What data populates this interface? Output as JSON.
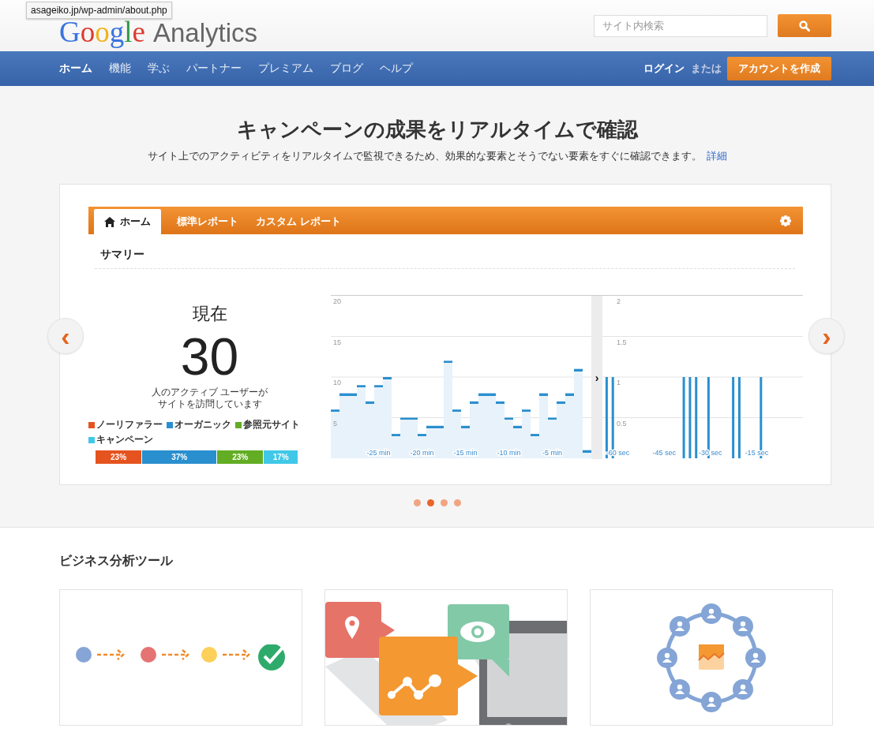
{
  "tooltip": "asageiko.jp/wp-admin/about.php",
  "logo": {
    "brand_letters": [
      {
        "char": "G",
        "color": "#3b73e0"
      },
      {
        "char": "o",
        "color": "#de3a2f"
      },
      {
        "char": "o",
        "color": "#f2b31b"
      },
      {
        "char": "g",
        "color": "#3b73e0"
      },
      {
        "char": "l",
        "color": "#2e9b48"
      },
      {
        "char": "e",
        "color": "#de3a2f"
      }
    ],
    "product": "Analytics"
  },
  "search": {
    "placeholder": "サイト内検索"
  },
  "nav": {
    "items": [
      {
        "label": "ホーム",
        "selected": true
      },
      {
        "label": "機能",
        "selected": false
      },
      {
        "label": "学ぶ",
        "selected": false
      },
      {
        "label": "パートナー",
        "selected": false
      },
      {
        "label": "プレミアム",
        "selected": false
      },
      {
        "label": "ブログ",
        "selected": false
      },
      {
        "label": "ヘルプ",
        "selected": false
      }
    ],
    "login": "ログイン",
    "or": "または",
    "signup": "アカウントを作成"
  },
  "hero": {
    "title": "キャンペーンの成果をリアルタイムで確認",
    "subtitle": "サイト上でのアクティビティをリアルタイムで監視できるため、効果的な要素とそうでない要素をすぐに確認できます。",
    "link": "詳細"
  },
  "dashboard": {
    "tabs": [
      {
        "label": "ホーム",
        "selected": true
      },
      {
        "label": "標準レポート",
        "selected": false
      },
      {
        "label": "カスタム レポート",
        "selected": false
      }
    ],
    "summary_title": "サマリー",
    "now_label": "現在",
    "active_count": "30",
    "description_lines": [
      "人のアクティブ ユーザーが",
      "サイトを訪問しています"
    ],
    "sources": [
      {
        "name": "ノーリファラー",
        "share": "23%",
        "color": "#e5541f"
      },
      {
        "name": "オーガニック",
        "share": "37%",
        "color": "#2a8fcf"
      },
      {
        "name": "参照元サイト",
        "share": "23%",
        "color": "#62ad23"
      },
      {
        "name": "キャンペーン",
        "share": "17%",
        "color": "#41c8e8"
      }
    ],
    "expander": "›",
    "minutes_chart": {
      "chart_data": {
        "type": "bar",
        "grid": true,
        "xlim": [
          -30.5,
          -0.5
        ],
        "x": [
          -30,
          -29,
          -28,
          -27,
          -26,
          -25,
          -24,
          -23,
          -22,
          -21,
          -20,
          -19,
          -18,
          -17,
          -16,
          -15,
          -14,
          -13,
          -12,
          -11,
          -10,
          -9,
          -8,
          -7,
          -6,
          -5,
          -4,
          -3,
          -2,
          -1
        ],
        "series": [
          {
            "color": "#2a8fcf",
            "values": [
              6,
              8,
              8,
              9,
              7,
              9,
              10,
              3,
              5,
              5,
              3,
              4,
              4,
              12,
              6,
              4,
              7,
              8,
              8,
              7,
              5,
              4,
              6,
              3,
              8,
              5,
              7,
              8,
              11,
              1
            ]
          }
        ],
        "ylim": [
          0,
          20
        ],
        "yticks": [
          5,
          10,
          15,
          20
        ],
        "xticks": [
          {
            "value": -25,
            "label": "-25 min"
          },
          {
            "value": -20,
            "label": "-20 min"
          },
          {
            "value": -15,
            "label": "-15 min"
          },
          {
            "value": -10,
            "label": "-10 min"
          },
          {
            "value": -5,
            "label": "-5 min"
          }
        ]
      }
    },
    "seconds_chart": {
      "chart_data": {
        "type": "bar",
        "grid": true,
        "x": [
          -64,
          -62,
          -39,
          -37,
          -35,
          -31,
          -23,
          -21,
          -14
        ],
        "series": [
          {
            "color": "#2a8fcf",
            "values": [
              1,
              1,
              1,
              1,
              1,
              1,
              1,
              1,
              1
            ]
          }
        ],
        "xlim": [
          -65,
          0
        ],
        "ylim": [
          0,
          2
        ],
        "yticks": [
          0.5,
          1,
          1.5,
          2
        ],
        "xticks": [
          {
            "value": -60,
            "label": "-60 sec"
          },
          {
            "value": -45,
            "label": "-45 sec"
          },
          {
            "value": -30,
            "label": "-30 sec"
          },
          {
            "value": -15,
            "label": "-15 sec"
          }
        ]
      }
    }
  },
  "carousel": {
    "prev": "‹",
    "next": "›",
    "dots": [
      {
        "selected": false
      },
      {
        "selected": true
      },
      {
        "selected": false
      },
      {
        "selected": false
      }
    ]
  },
  "tools": {
    "heading": "ビジネス分析ツール",
    "cards": [
      {
        "kind": "flow"
      },
      {
        "kind": "bubbles"
      },
      {
        "kind": "network"
      }
    ]
  }
}
